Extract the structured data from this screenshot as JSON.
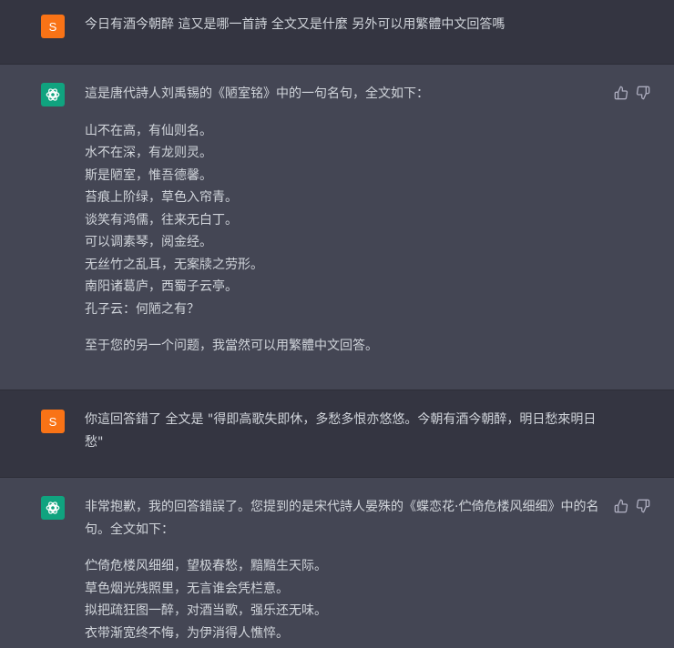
{
  "conversation": {
    "user1": {
      "avatar_letter": "S",
      "text": "今日有酒今朝醉 這又是哪一首詩 全文又是什麼 另外可以用繁體中文回答嗎"
    },
    "assistant1": {
      "intro": "這是唐代詩人刘禹锡的《陋室铭》中的一句名句，全文如下：",
      "poem": [
        "山不在高，有仙则名。",
        "水不在深，有龙则灵。",
        "斯是陋室，惟吾德馨。",
        "苔痕上阶绿，草色入帘青。",
        "谈笑有鸿儒，往来无白丁。",
        "可以调素琴，阅金经。",
        "无丝竹之乱耳，无案牍之劳形。",
        "南阳诸葛庐，西蜀子云亭。",
        "孔子云：何陋之有？"
      ],
      "closing": "至于您的另一个问题，我當然可以用繁體中文回答。"
    },
    "user2": {
      "avatar_letter": "S",
      "lines": [
        "你這回答錯了 全文是 \"得即高歌失即休，多愁多恨亦悠悠。今朝有酒今朝醉，明日愁來明日",
        "愁\""
      ]
    },
    "assistant2": {
      "intro_lines": [
        "非常抱歉，我的回答錯誤了。您提到的是宋代詩人晏殊的《蝶恋花·伫倚危楼风细细》中的名",
        "句。全文如下："
      ],
      "poem": [
        "伫倚危楼风细细，望极春愁，黯黯生天际。",
        "草色烟光残照里，无言谁会凭栏意。",
        "拟把疏狂图一醉，对酒当歌，强乐还无味。",
        "衣带渐宽终不悔，为伊消得人憔悴。"
      ]
    }
  },
  "icons": {
    "thumbs_up": "thumbs-up-icon",
    "thumbs_down": "thumbs-down-icon",
    "assistant_logo": "openai-logo-icon"
  },
  "colors": {
    "user_bg": "#343541",
    "assistant_bg": "#444654",
    "user_avatar": "#f97316",
    "assistant_avatar": "#10a37f",
    "text": "#d1d5db"
  }
}
